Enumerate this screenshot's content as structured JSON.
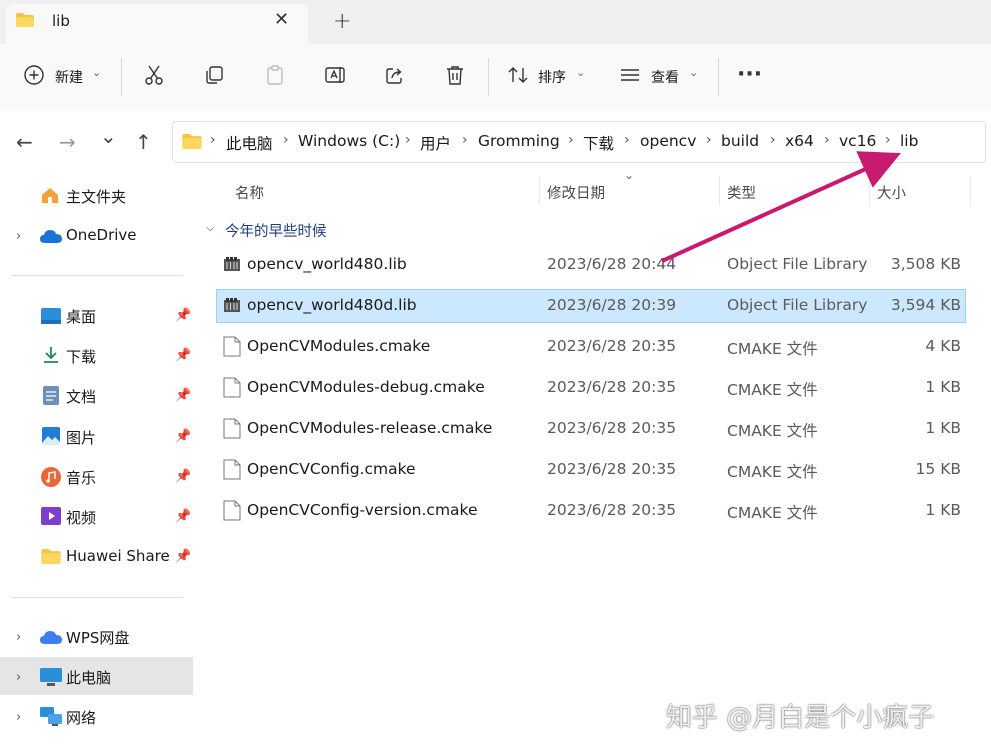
{
  "tab": {
    "title": "lib",
    "close": "✕",
    "new": "+"
  },
  "toolbar": {
    "new_label": "新建",
    "sort_label": "排序",
    "view_label": "查看",
    "more": "···"
  },
  "nav": {
    "back": "←",
    "forward": "→",
    "recent": "⌄",
    "up": "↑"
  },
  "breadcrumb": [
    "此电脑",
    "Windows (C:)",
    "用户",
    "Gromming",
    "下载",
    "opencv",
    "build",
    "x64",
    "vc16",
    "lib"
  ],
  "sidebar": {
    "home": "主文件夹",
    "onedrive": "OneDrive",
    "pinned": [
      "桌面",
      "下载",
      "文档",
      "图片",
      "音乐",
      "视频",
      "Huawei Share"
    ],
    "wps": "WPS网盘",
    "this_pc": "此电脑",
    "network": "网络"
  },
  "columns": {
    "name": "名称",
    "modified": "修改日期",
    "type": "类型",
    "size": "大小"
  },
  "group": "今年的早些时候",
  "files": [
    {
      "name": "opencv_world480.lib",
      "modified": "2023/6/28 20:44",
      "type": "Object File Library",
      "size": "3,508 KB",
      "icon": "lib-file-icon"
    },
    {
      "name": "opencv_world480d.lib",
      "modified": "2023/6/28 20:39",
      "type": "Object File Library",
      "size": "3,594 KB",
      "icon": "lib-file-icon",
      "selected": true
    },
    {
      "name": "OpenCVModules.cmake",
      "modified": "2023/6/28 20:35",
      "type": "CMAKE 文件",
      "size": "4 KB",
      "icon": "document-icon"
    },
    {
      "name": "OpenCVModules-debug.cmake",
      "modified": "2023/6/28 20:35",
      "type": "CMAKE 文件",
      "size": "1 KB",
      "icon": "document-icon"
    },
    {
      "name": "OpenCVModules-release.cmake",
      "modified": "2023/6/28 20:35",
      "type": "CMAKE 文件",
      "size": "1 KB",
      "icon": "document-icon"
    },
    {
      "name": "OpenCVConfig.cmake",
      "modified": "2023/6/28 20:35",
      "type": "CMAKE 文件",
      "size": "15 KB",
      "icon": "document-icon"
    },
    {
      "name": "OpenCVConfig-version.cmake",
      "modified": "2023/6/28 20:35",
      "type": "CMAKE 文件",
      "size": "1 KB",
      "icon": "document-icon"
    }
  ],
  "watermark": "知乎 @月白是个小疯子",
  "colors": {
    "selection": "#cce8ff",
    "selection_border": "#99d1ff",
    "annotation_arrow": "#c81a6e",
    "folder": "#f4c542"
  }
}
